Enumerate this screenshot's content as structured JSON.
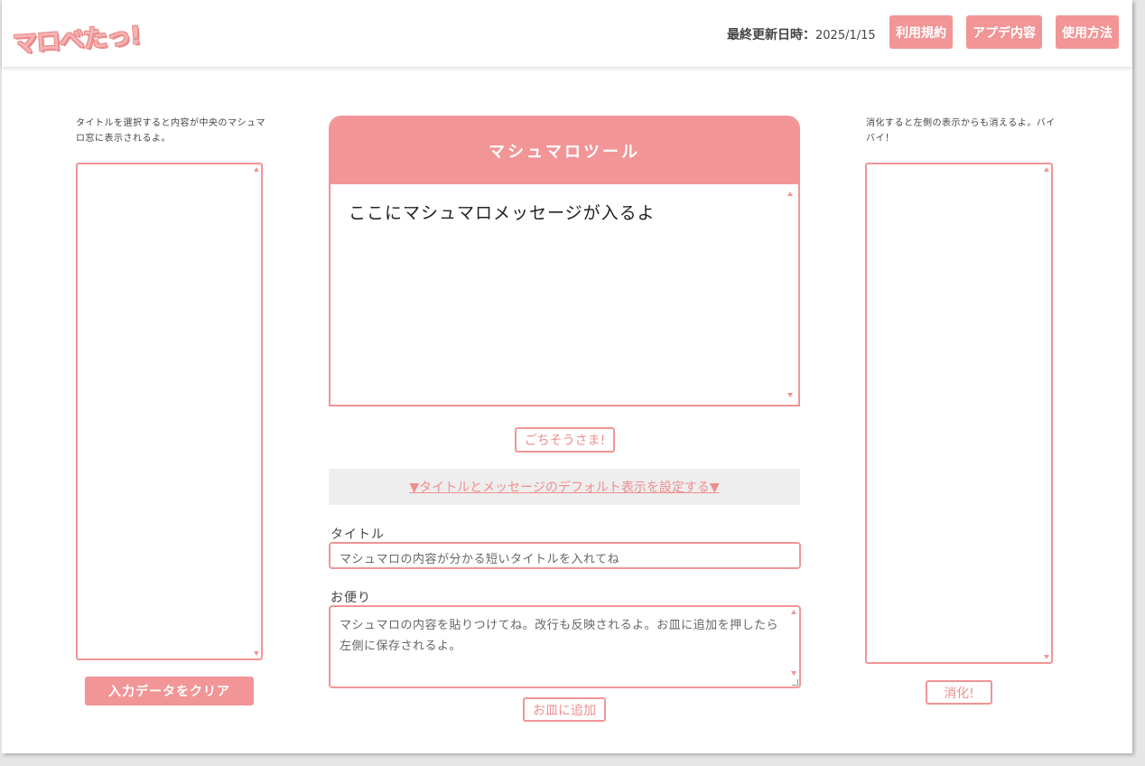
{
  "header": {
    "logo": "マロべたっ!",
    "last_updated_label": "最終更新日時：",
    "last_updated_date": "2025/1/15",
    "buttons": {
      "terms": "利用規約",
      "update": "アプデ内容",
      "usage": "使用方法"
    }
  },
  "left": {
    "hint": "タイトルを選択すると内容が中央のマシュマロ窓に表示されるよ。",
    "clear_label": "入力データをクリア"
  },
  "center": {
    "tool_title": "マシュマロツール",
    "message_display": "ここにマシュマロメッセージが入るよ",
    "thanks_label": "ごちそうさま!",
    "default_setting_link": "▼タイトルとメッセージのデフォルト表示を設定する▼",
    "title_label": "タイトル",
    "title_placeholder": "マシュマロの内容が分かる短いタイトルを入れてね",
    "message_label": "お便り",
    "message_placeholder": "マシュマロの内容を貼りつけてね。改行も反映されるよ。お皿に追加を押したら左側に保存されるよ。",
    "add_label": "お皿に追加"
  },
  "right": {
    "hint": "消化すると左側の表示からも消えるよ。バイバイ！",
    "digest_label": "消化!"
  },
  "colors": {
    "accent": "#f19596",
    "accent_text": "#ef8e8f",
    "bar_bg": "#eeeeee"
  }
}
